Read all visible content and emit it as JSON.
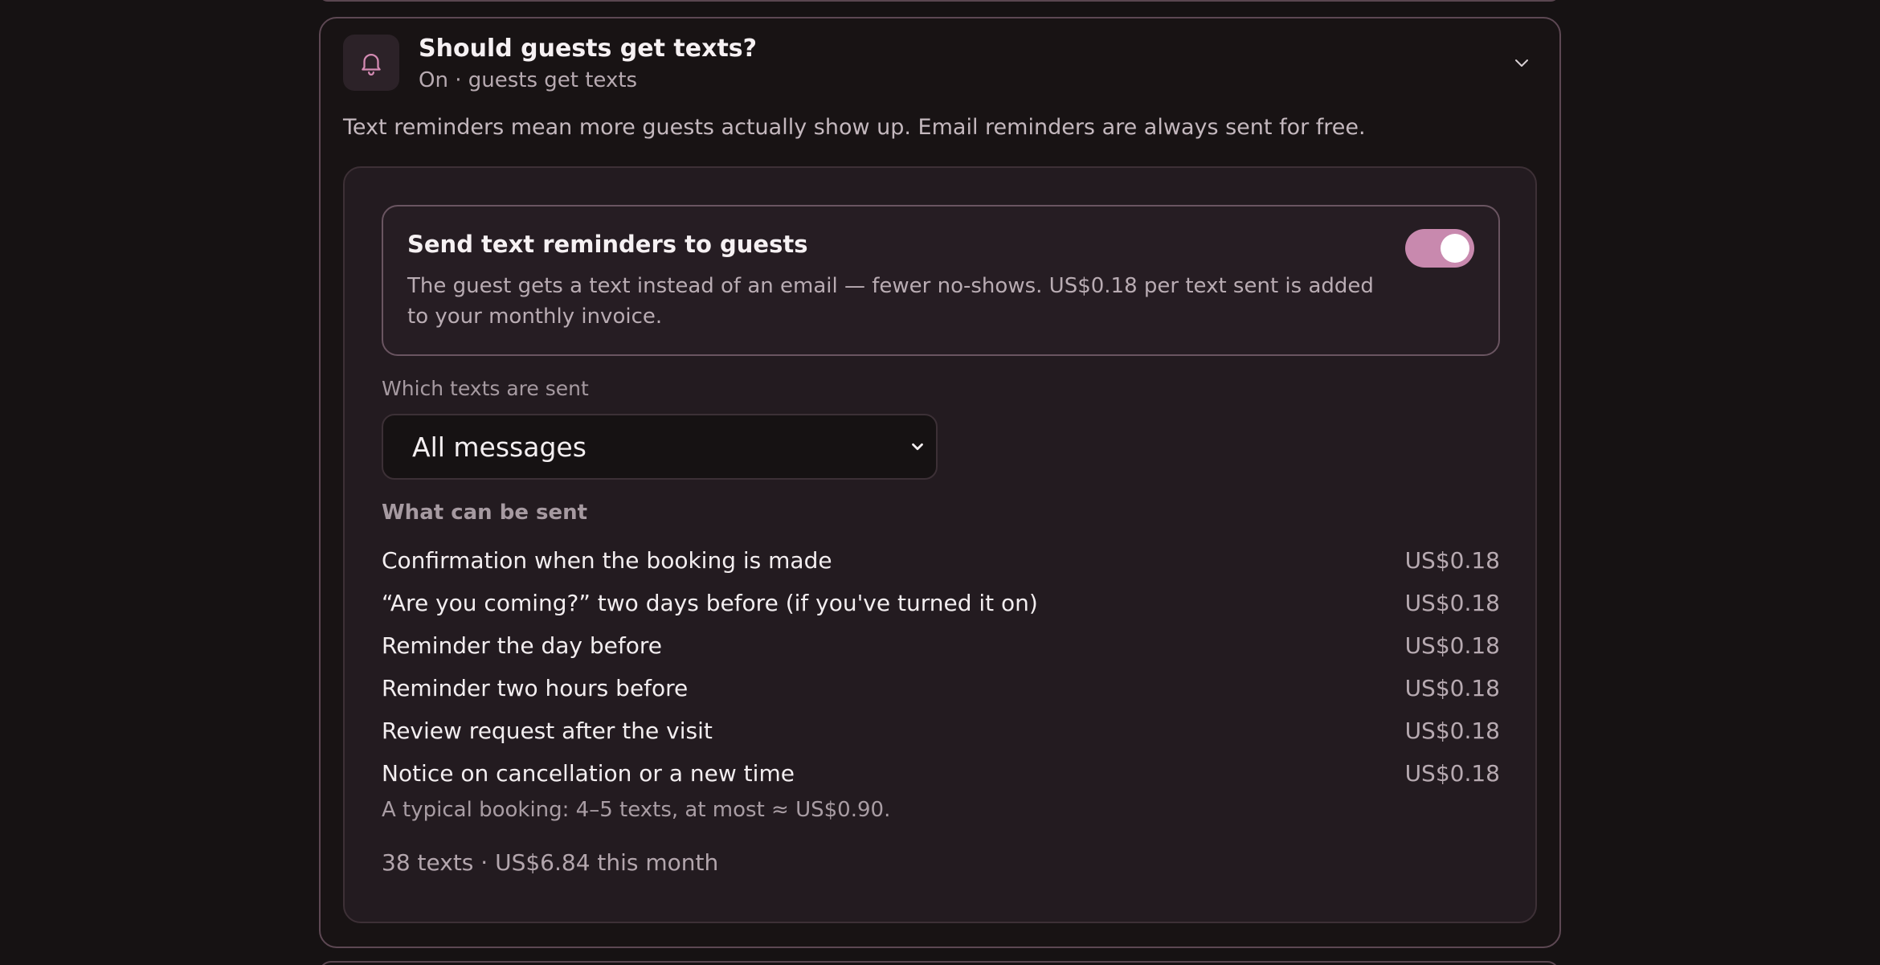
{
  "section": {
    "title": "Should guests get texts?",
    "subtitle": "On · guests get texts",
    "intro": "Text reminders mean more guests actually show up. Email reminders are always sent for free.",
    "icon": "bell-icon",
    "expand_icon": "chevron-down-icon"
  },
  "sms_toggle": {
    "title": "Send text reminders to guests",
    "description": "The guest gets a text instead of an email — fewer no‑shows. US$0.18 per text sent is added to your monthly invoice.",
    "enabled": true,
    "accent_color": "#c889ae"
  },
  "which_texts": {
    "label": "Which texts are sent",
    "selected": "All messages"
  },
  "what_can_be_sent": {
    "label": "What can be sent",
    "items": [
      {
        "label": "Confirmation when the booking is made",
        "price": "US$0.18"
      },
      {
        "label": "“Are you coming?” two days before (if you've turned it on)",
        "price": "US$0.18"
      },
      {
        "label": "Reminder the day before",
        "price": "US$0.18"
      },
      {
        "label": "Reminder two hours before",
        "price": "US$0.18"
      },
      {
        "label": "Review request after the visit",
        "price": "US$0.18"
      },
      {
        "label": "Notice on cancellation or a new time",
        "price": "US$0.18"
      }
    ]
  },
  "typical_note": "A typical booking: 4–5 texts, at most ≈ US$0.90.",
  "usage_summary": "38 texts · US$6.84 this month"
}
